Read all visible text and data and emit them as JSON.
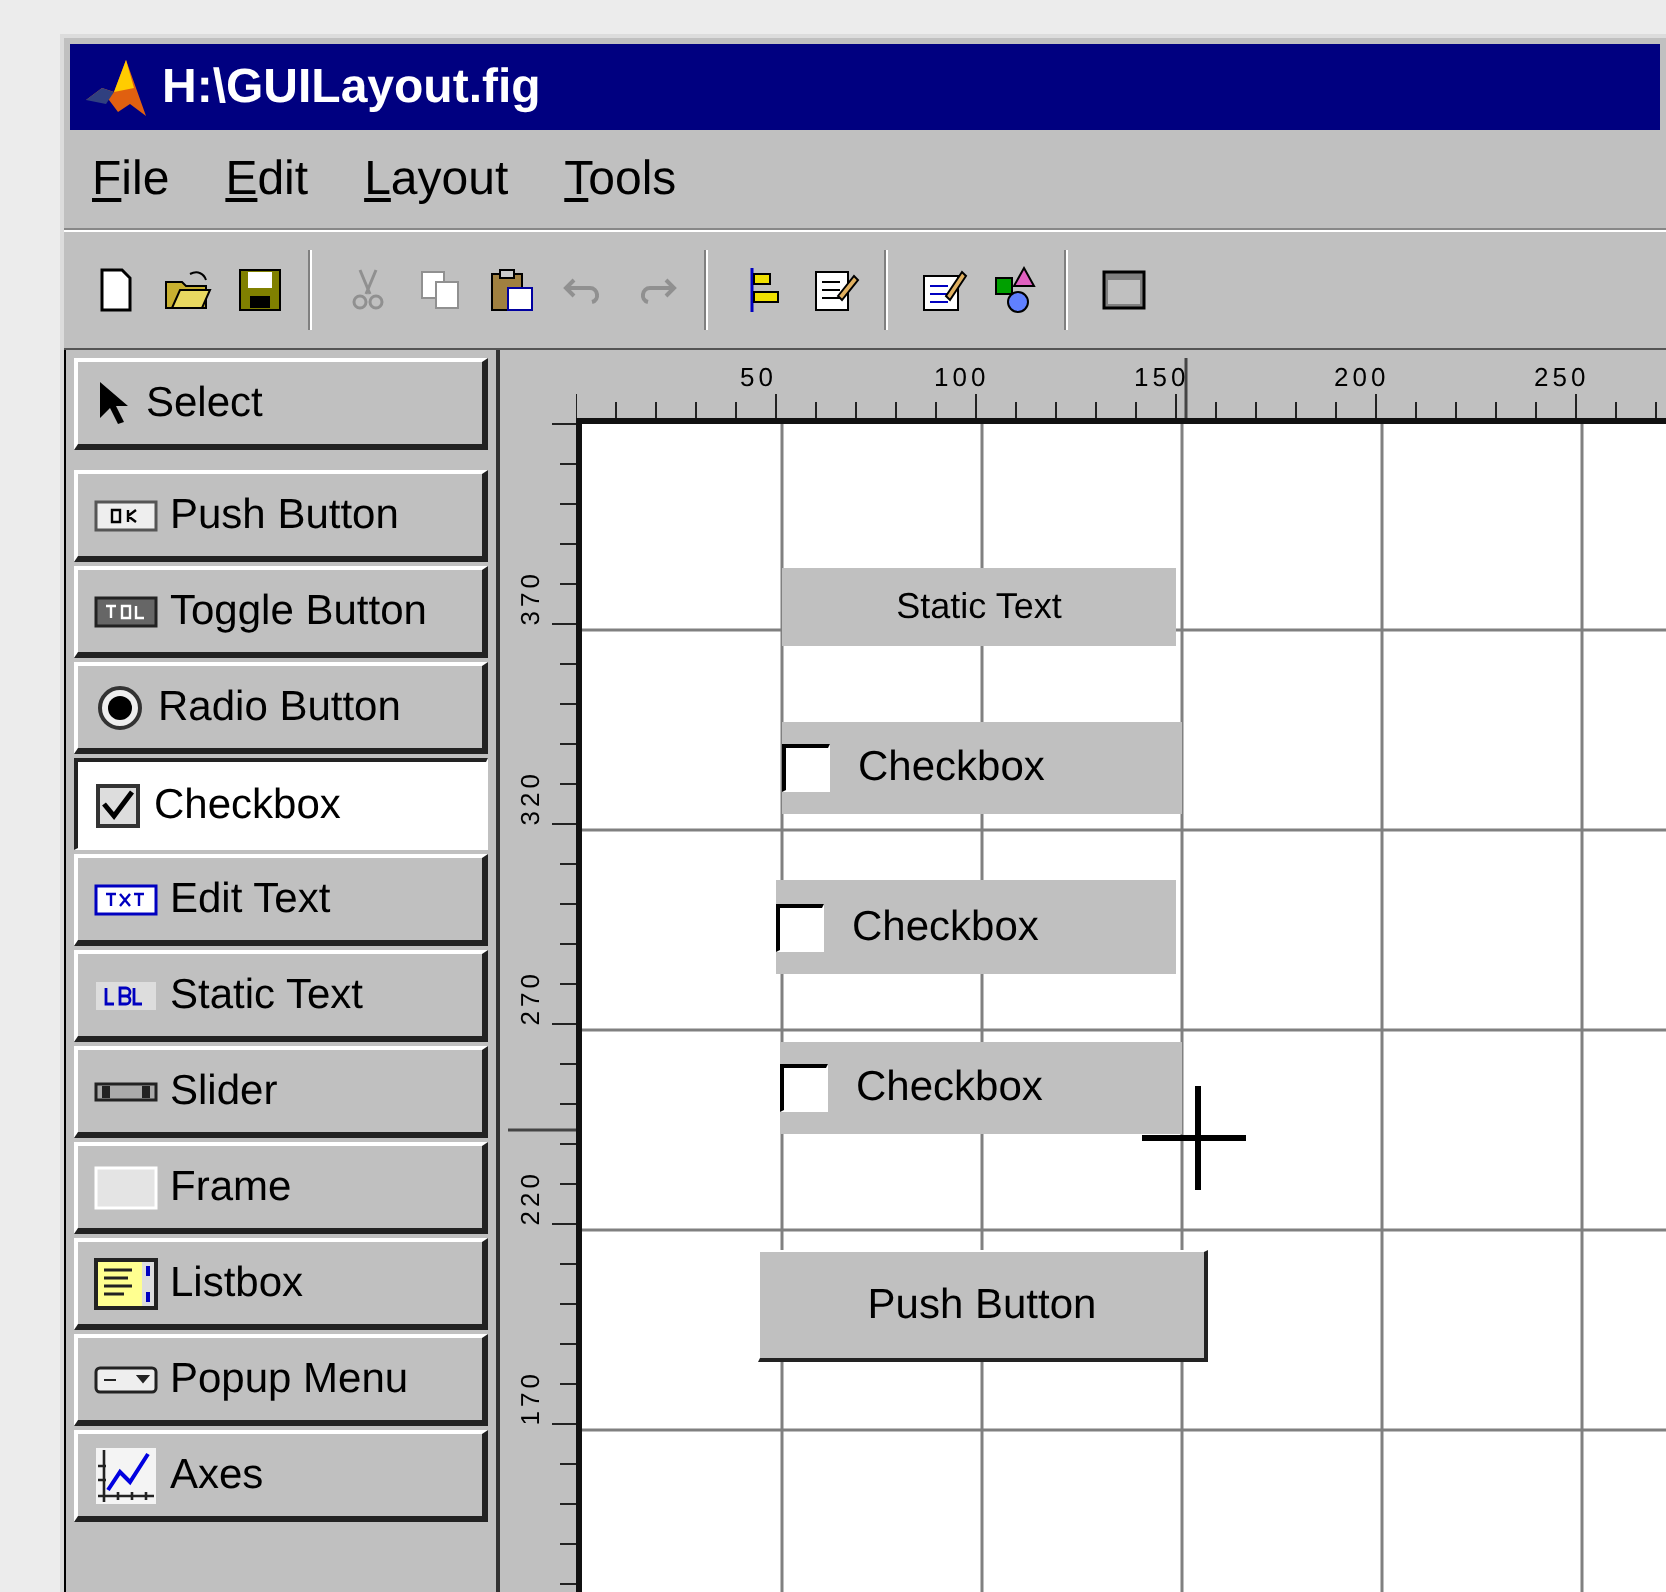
{
  "window": {
    "title": "H:\\GUILayout.fig"
  },
  "menu": [
    {
      "label": "File"
    },
    {
      "label": "Edit"
    },
    {
      "label": "Layout"
    },
    {
      "label": "Tools"
    }
  ],
  "toolbar": [
    [
      {
        "kind": "new",
        "disabled": false
      },
      {
        "kind": "open",
        "disabled": false
      },
      {
        "kind": "save",
        "disabled": false
      }
    ],
    [
      {
        "kind": "cut",
        "disabled": true
      },
      {
        "kind": "copy",
        "disabled": true
      },
      {
        "kind": "paste",
        "disabled": false
      },
      {
        "kind": "undo",
        "disabled": true
      },
      {
        "kind": "redo",
        "disabled": true
      }
    ],
    [
      {
        "kind": "align",
        "disabled": false
      },
      {
        "kind": "property",
        "disabled": false
      }
    ],
    [
      {
        "kind": "menu_editor",
        "disabled": false
      },
      {
        "kind": "browser",
        "disabled": false
      }
    ],
    [
      {
        "kind": "figure",
        "disabled": false
      }
    ]
  ],
  "palette": [
    {
      "kind": "select",
      "label": "Select",
      "selected": false
    },
    {
      "kind": "push",
      "label": "Push Button",
      "selected": false
    },
    {
      "kind": "toggle",
      "label": "Toggle Button",
      "selected": false
    },
    {
      "kind": "radio",
      "label": "Radio Button",
      "selected": false
    },
    {
      "kind": "checkbox",
      "label": "Checkbox",
      "selected": true
    },
    {
      "kind": "edit",
      "label": "Edit Text",
      "selected": false
    },
    {
      "kind": "static",
      "label": "Static Text",
      "selected": false
    },
    {
      "kind": "slider",
      "label": "Slider",
      "selected": false
    },
    {
      "kind": "frame",
      "label": "Frame",
      "selected": false
    },
    {
      "kind": "listbox",
      "label": "Listbox",
      "selected": false
    },
    {
      "kind": "popup",
      "label": "Popup Menu",
      "selected": false
    },
    {
      "kind": "axes",
      "label": "Axes",
      "selected": false
    }
  ],
  "ruler": {
    "x_labels": [
      "50",
      "100",
      "150",
      "200",
      "250"
    ],
    "y_labels": [
      "370",
      "320",
      "270",
      "220",
      "170"
    ]
  },
  "canvas": {
    "objects": [
      {
        "kind": "static_text",
        "label": "Static Text"
      },
      {
        "kind": "checkbox",
        "label": "Checkbox",
        "checked": false
      },
      {
        "kind": "checkbox",
        "label": "Checkbox",
        "checked": false
      },
      {
        "kind": "checkbox",
        "label": "Checkbox",
        "checked": false
      },
      {
        "kind": "push_button",
        "label": "Push Button"
      }
    ]
  }
}
